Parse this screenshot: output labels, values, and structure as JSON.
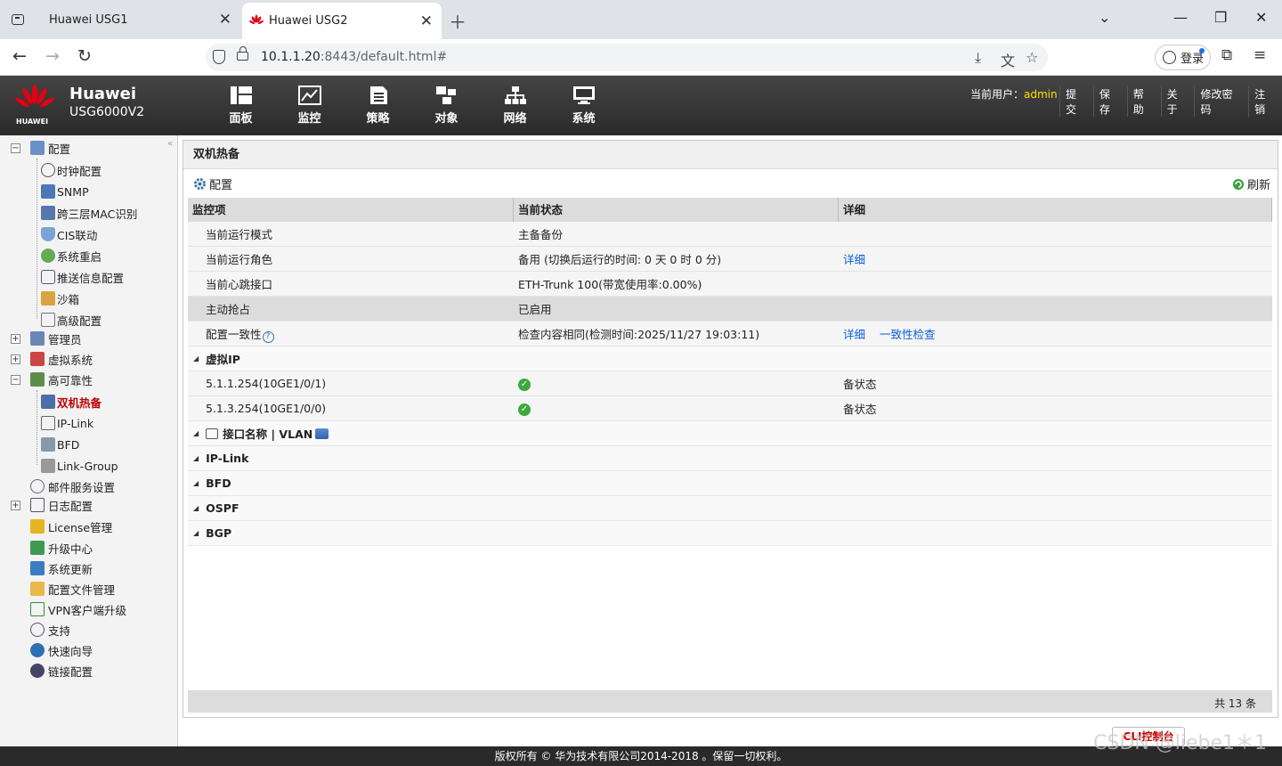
{
  "browser": {
    "tabs": [
      {
        "title": "Huawei USG1",
        "active": false
      },
      {
        "title": "Huawei USG2",
        "active": true
      }
    ],
    "url_host": "10.1.1.20",
    "url_rest": ":8443/default.html#",
    "login_label": "登录"
  },
  "header": {
    "brand_name": "Huawei",
    "model": "USG6000V2",
    "logo_text": "HUAWEI",
    "nav": [
      {
        "label": "面板",
        "icon": "dashboard-icon"
      },
      {
        "label": "监控",
        "icon": "monitor-chart-icon"
      },
      {
        "label": "策略",
        "icon": "policy-document-icon"
      },
      {
        "label": "对象",
        "icon": "object-icon"
      },
      {
        "label": "网络",
        "icon": "network-icon"
      },
      {
        "label": "系统",
        "icon": "system-monitor-icon"
      }
    ],
    "current_user_label": "当前用户：",
    "current_user": "admin",
    "menu": [
      "提交",
      "保存",
      "帮助",
      "关于",
      "修改密码",
      "注销"
    ]
  },
  "sidebar": {
    "config": "配置",
    "config_children": [
      "时钟配置",
      "SNMP",
      "跨三层MAC识别",
      "CIS联动",
      "系统重启",
      "推送信息配置",
      "沙箱",
      "高级配置"
    ],
    "admin": "管理员",
    "vsys": "虚拟系统",
    "ha": "高可靠性",
    "ha_children": [
      "双机热备",
      "IP-Link",
      "BFD",
      "Link-Group"
    ],
    "mail": "邮件服务设置",
    "log": "日志配置",
    "rest": [
      "License管理",
      "升级中心",
      "系统更新",
      "配置文件管理",
      "VPN客户端升级",
      "支持",
      "快速向导",
      "链接配置"
    ]
  },
  "content": {
    "title": "双机热备",
    "config_btn": "配置",
    "refresh_btn": "刷新",
    "columns": [
      "监控项",
      "当前状态",
      "详细"
    ],
    "rows": [
      {
        "item": "当前运行模式",
        "status": "主备备份",
        "detail": ""
      },
      {
        "item": "当前运行角色",
        "status": "备用 (切换后运行的时间: 0 天 0 时 0 分)",
        "detail": "详细"
      },
      {
        "item": "当前心跳接口",
        "status": "ETH-Trunk 100(带宽使用率:0.00%)",
        "detail": ""
      },
      {
        "item": "主动抢占",
        "status": "已启用",
        "detail": ""
      },
      {
        "item": "配置一致性",
        "status": "检查内容相同(检测时间:2025/11/27 19:03:11)",
        "detail": "详细",
        "detail2": "一致性检查"
      }
    ],
    "vip_group": "虚拟IP",
    "vip_rows": [
      {
        "item": "5.1.1.254(10GE1/0/1)",
        "state": "备状态"
      },
      {
        "item": "5.1.3.254(10GE1/0/0)",
        "state": "备状态"
      }
    ],
    "groups": [
      "接口名称 | VLAN",
      "IP-Link",
      "BFD",
      "OSPF",
      "BGP"
    ],
    "total": "共 13 条"
  },
  "cli_button": "CLI控制台",
  "copyright": "版权所有 © 华为技术有限公司2014-2018 。保留一切权利。",
  "watermark": "CSDN @liebe1＊1"
}
